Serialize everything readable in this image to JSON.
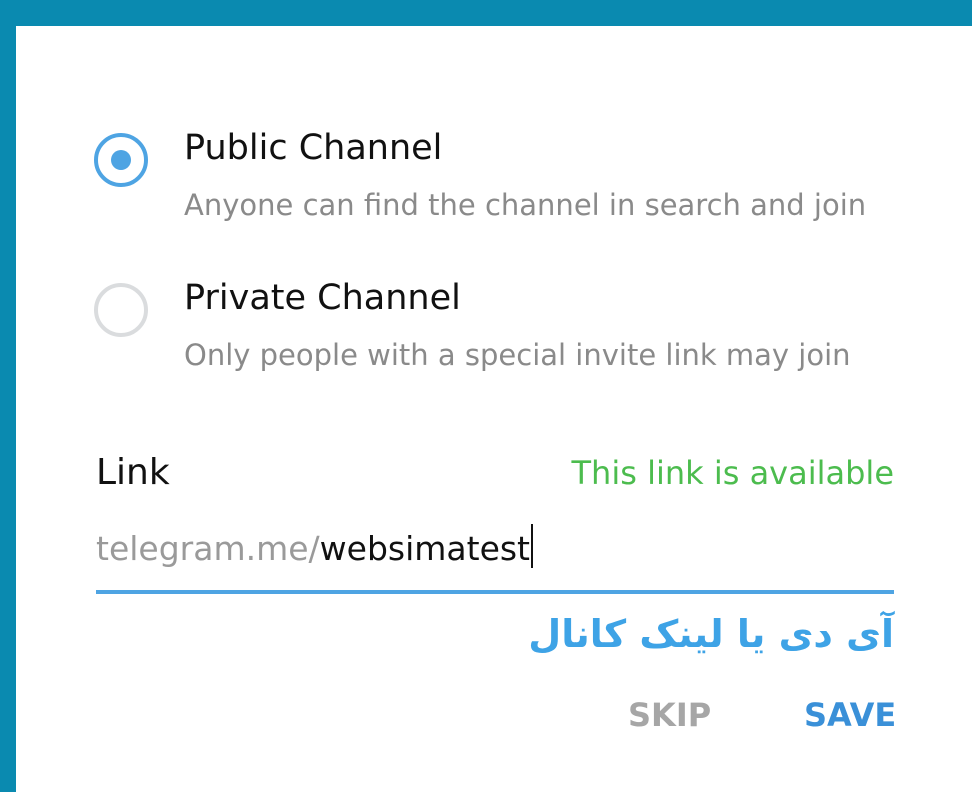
{
  "colors": {
    "background_frame": "#0a8ab0",
    "dialog_background": "#ffffff",
    "accent": "#4ea4e3",
    "available_green": "#4cbc4e",
    "muted_text": "#8a8a8a",
    "caption_blue": "#3ea3e6",
    "skip_gray": "#a6a6a6",
    "save_blue": "#3a90d8"
  },
  "channel_type": {
    "selected": "public",
    "options": [
      {
        "id": "public",
        "title": "Public Channel",
        "description": "Anyone can find the channel in search and join",
        "checked": true
      },
      {
        "id": "private",
        "title": "Private Channel",
        "description": "Only people with a special invite link may join",
        "checked": false
      }
    ]
  },
  "link": {
    "label": "Link",
    "status": "This link is available",
    "prefix": "telegram.me/",
    "value": "websimatest"
  },
  "caption": "آی دی یا لینک کانال",
  "actions": {
    "skip_label": "SKIP",
    "save_label": "SAVE"
  }
}
